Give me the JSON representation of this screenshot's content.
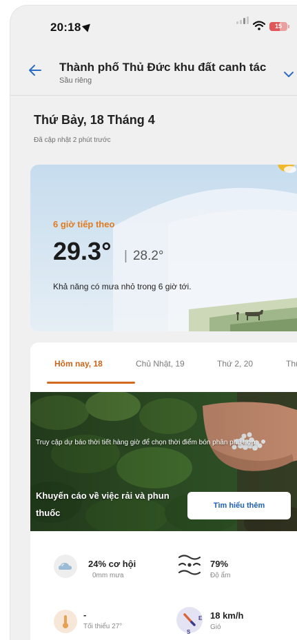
{
  "status_bar": {
    "time": "20:18",
    "battery": "15"
  },
  "header": {
    "title": "Thành phố Thủ Đức khu đất canh tác",
    "subtitle": "Sầu riêng"
  },
  "date": {
    "title": "Thứ Bảy, 18 Tháng 4",
    "updated": "Đã cập nhật 2 phút trước"
  },
  "weather": {
    "next_label": "6 giờ tiếp theo",
    "temp_main": "29.3°",
    "temp_secondary": "28.2°",
    "message": "Khả năng có mưa nhỏ trong 6 giờ tới."
  },
  "tabs": [
    {
      "label": "Hôm nay, 18",
      "active": true
    },
    {
      "label": "Chủ Nhật, 19",
      "active": false
    },
    {
      "label": "Thứ 2, 20",
      "active": false
    },
    {
      "label": "Thứ",
      "active": false
    }
  ],
  "banner": {
    "text": "Truy cập dự báo thời tiết hàng giờ để chọn thời điểm bón phân phù hợp.",
    "title": "Khuyến cáo về việc rải và phun thuốc",
    "button": "Tìm hiểu thêm"
  },
  "stats": {
    "rain": {
      "value": "24% cơ hội",
      "sub": "0mm mưa",
      "icon": "cloud-rain-icon"
    },
    "humidity": {
      "value": "79%",
      "sub": "Độ ẩm",
      "icon": "humidity-waves-icon"
    },
    "temp_min": {
      "value": "-",
      "sub": "Tối thiểu 27°",
      "icon": "thermometer-icon"
    },
    "wind": {
      "value": "18 km/h",
      "sub": "Gió",
      "icon": "compass-wind-icon",
      "compass_e": "E",
      "compass_s": "S"
    }
  },
  "colors": {
    "accent": "#d2691e",
    "link": "#1f5fb0",
    "back_arrow": "#2a6cc4"
  }
}
